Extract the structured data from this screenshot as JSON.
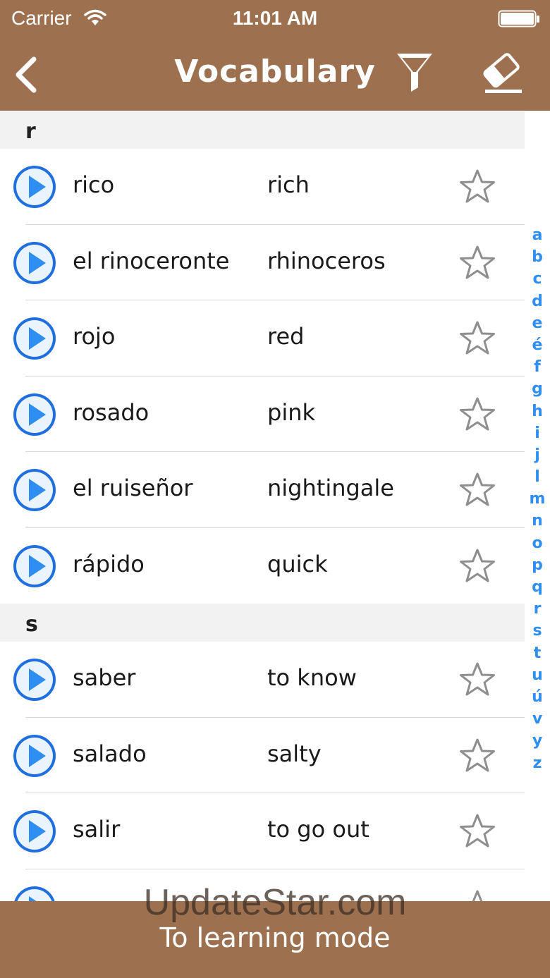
{
  "status_bar": {
    "carrier": "Carrier",
    "time": "11:01 AM"
  },
  "nav": {
    "title": "Vocabulary",
    "back_icon": "chevron-left-icon",
    "filter_icon": "filter-icon",
    "eraser_icon": "eraser-icon"
  },
  "sections": [
    {
      "letter": "r",
      "rows": [
        {
          "es": "rico",
          "en": "rich"
        },
        {
          "es": "el rinoceronte",
          "en": "rhinoceros"
        },
        {
          "es": "rojo",
          "en": "red"
        },
        {
          "es": "rosado",
          "en": "pink"
        },
        {
          "es": "el ruiseñor",
          "en": "nightingale"
        },
        {
          "es": "rápido",
          "en": "quick"
        }
      ]
    },
    {
      "letter": "s",
      "rows": [
        {
          "es": "saber",
          "en": "to know"
        },
        {
          "es": "salado",
          "en": "salty"
        },
        {
          "es": "salir",
          "en": "to go out"
        },
        {
          "es": "",
          "en": ""
        }
      ]
    }
  ],
  "index_letters": [
    "a",
    "b",
    "c",
    "d",
    "e",
    "é",
    "f",
    "g",
    "h",
    "i",
    "j",
    "l",
    "m",
    "n",
    "o",
    "p",
    "q",
    "r",
    "s",
    "t",
    "u",
    "ú",
    "v",
    "y",
    "z"
  ],
  "bottom_bar": {
    "label": "To learning mode"
  },
  "watermark": "UpdateStar.com",
  "colors": {
    "brand_brown": "#9d7150",
    "index_blue": "#2f8ef2",
    "section_bg": "#f2f2f2"
  }
}
